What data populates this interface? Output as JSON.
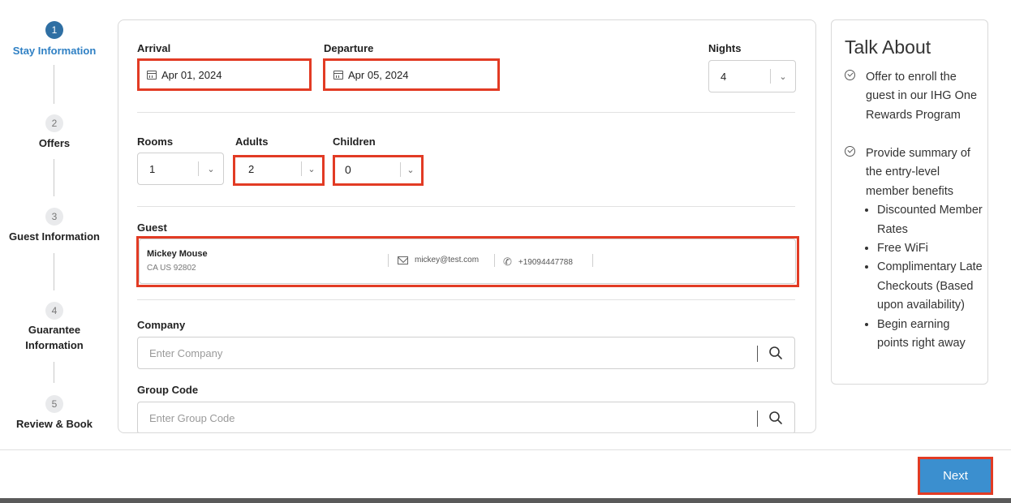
{
  "stepper": {
    "steps": [
      {
        "number": "1",
        "label": "Stay Information"
      },
      {
        "number": "2",
        "label": "Offers"
      },
      {
        "number": "3",
        "label": "Guest Information"
      },
      {
        "number": "4",
        "label": "Guarantee\nInformation"
      },
      {
        "number": "5",
        "label": "Review & Book"
      }
    ]
  },
  "stay": {
    "arrival_label": "Arrival",
    "arrival_value": "Apr 01, 2024",
    "departure_label": "Departure",
    "departure_value": "Apr 05, 2024",
    "nights_label": "Nights",
    "nights_value": "4"
  },
  "occupancy": {
    "rooms_label": "Rooms",
    "rooms_value": "1",
    "adults_label": "Adults",
    "adults_value": "2",
    "children_label": "Children",
    "children_value": "0"
  },
  "guest": {
    "label": "Guest",
    "name": "Mickey Mouse",
    "address": "CA US 92802",
    "email": "mickey@test.com",
    "phone": "+19094447788"
  },
  "company": {
    "label": "Company",
    "placeholder": "Enter Company"
  },
  "group_code": {
    "label": "Group Code",
    "placeholder": "Enter Group Code"
  },
  "talk_about": {
    "title": "Talk About",
    "item1": "Offer to enroll the guest in our IHG One Rewards Program",
    "item2": "Provide summary of the entry-level member benefits",
    "benefits": [
      "Discounted Member Rates",
      "Free WiFi",
      "Complimentary Late Checkouts (Based upon availability)",
      "Begin earning points right away"
    ]
  },
  "footer": {
    "next_label": "Next"
  },
  "colors": {
    "accent": "#3b8fcf",
    "active_step": "#2f6fa3",
    "highlight": "#e23b24"
  }
}
